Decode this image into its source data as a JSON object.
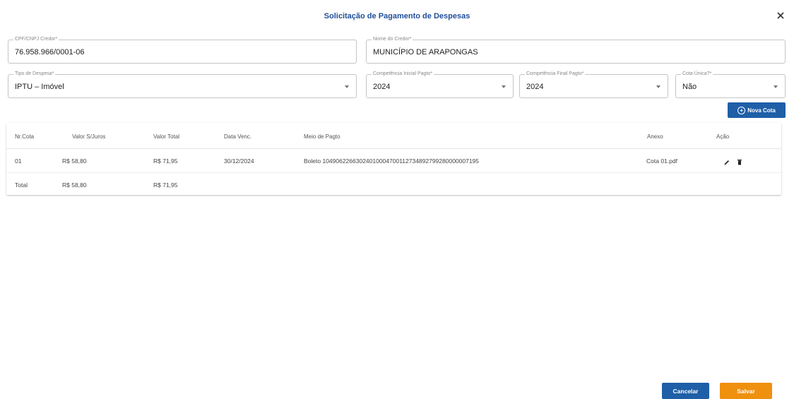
{
  "dialog": {
    "title": "Solicitação de Pagamento de Despesas"
  },
  "icons": {
    "close": "close-icon",
    "add": "add-circle-icon",
    "edit": "pencil-icon",
    "delete": "trash-icon",
    "dropdown": "chevron-down-icon"
  },
  "colors": {
    "primary": "#1f5fa8",
    "title": "#1f4e9a",
    "save": "#f0900f"
  },
  "form": {
    "cpf": {
      "label": "CPF/CNPJ Credor*",
      "value": "76.958.966/0001-06"
    },
    "credor": {
      "label": "Nome do Credor*",
      "value": "MUNICÍPIO DE ARAPONGAS"
    },
    "tipo": {
      "label": "Tipo de Despesa*",
      "value": "IPTU – Imóvel"
    },
    "comp_inicial": {
      "label": "Competência Inicial Pagto*",
      "value": "2024"
    },
    "comp_final": {
      "label": "Competência Final Pagto*",
      "value": "2024"
    },
    "cota_unica": {
      "label": "Cota Única?*",
      "value": "Não"
    }
  },
  "buttons": {
    "nova_cota": "Nova Cota",
    "cancelar": "Cancelar",
    "salvar": "Salvar"
  },
  "table": {
    "headers": {
      "nr": "Nr.Cota",
      "valor_sj": "Valor S/Juros",
      "valor_total": "Valor Total",
      "data_venc": "Data Venc.",
      "meio": "Meio de Pagto",
      "anexo": "Anexo",
      "acao": "Ação"
    },
    "rows": [
      {
        "nr": "01",
        "valor_sj": "R$ 58,80",
        "valor_total": "R$ 71,95",
        "data_venc": "30/12/2024",
        "meio": "Boleto 10490622663024010004700112734892799280000007195",
        "anexo": "Cota 01.pdf"
      }
    ],
    "total": {
      "label": "Total",
      "valor_sj": "R$ 58,80",
      "valor_total": "R$ 71,95"
    }
  }
}
